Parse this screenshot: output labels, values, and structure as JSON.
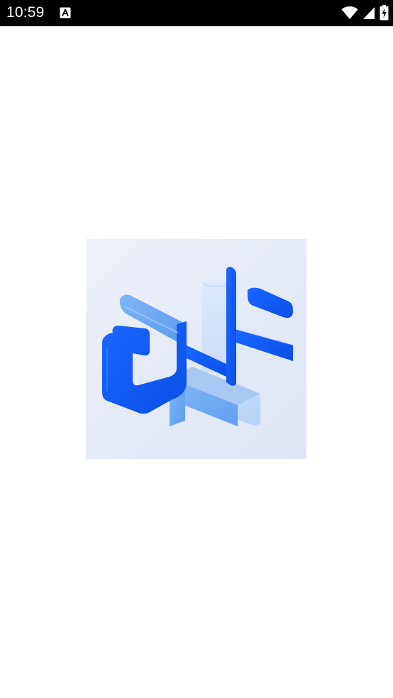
{
  "status_bar": {
    "time": "10:59",
    "notification_icon": "font-a-icon",
    "wifi_icon": "wifi-icon",
    "signal_icon": "cellular-signal-icon",
    "battery_icon": "battery-charging-icon"
  },
  "splash": {
    "logo_icon": "app-logo-icon",
    "brand_color": "#1560ff",
    "accent_color": "#6aa8f2"
  }
}
